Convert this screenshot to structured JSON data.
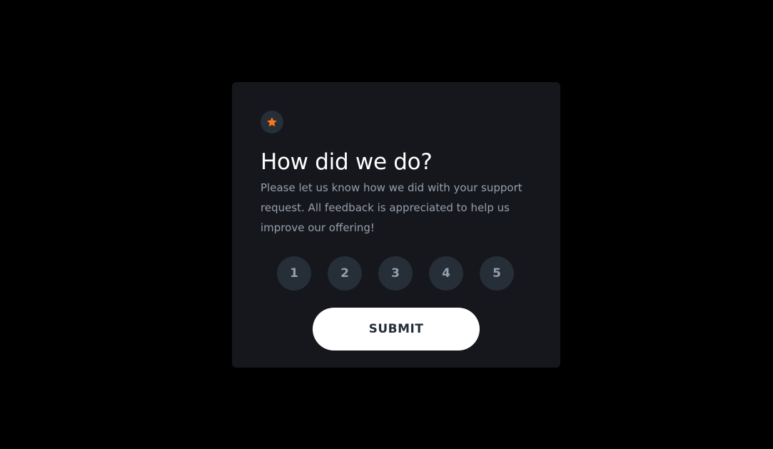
{
  "card": {
    "icon": "star-icon",
    "title": "How did we do?",
    "description": "Please let us know how we did with your support request. All feedback is appreciated to help us improve our offering!",
    "ratings": [
      "1",
      "2",
      "3",
      "4",
      "5"
    ],
    "submit_label": "SUBMIT"
  },
  "colors": {
    "page_background": "#000000",
    "card_background": "#15171c",
    "circle_background": "#262e38",
    "accent_orange": "#fc7614",
    "muted_text": "#969fad",
    "title_text": "#ffffff",
    "button_background": "#ffffff",
    "button_text": "#262e38"
  }
}
